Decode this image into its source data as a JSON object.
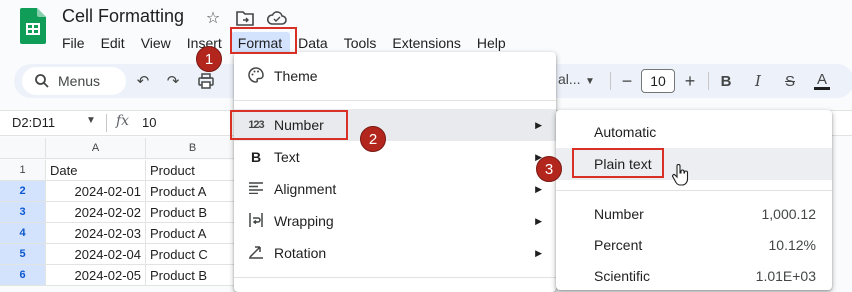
{
  "app": {
    "title": "Cell Formatting",
    "logo_icon": "sheets-logo",
    "brand_color": "#0f9d58"
  },
  "menubar": [
    "File",
    "Edit",
    "View",
    "Insert",
    "Format",
    "Data",
    "Tools",
    "Extensions",
    "Help"
  ],
  "toolbar": {
    "search_label": "Menus",
    "font_size": "10",
    "font_fragment": "al...",
    "icons": [
      "search-icon",
      "undo-icon",
      "redo-icon",
      "print-icon",
      "minus-icon",
      "plus-icon",
      "bold-icon",
      "italic-icon",
      "strikethrough-icon",
      "text-color-icon"
    ]
  },
  "formula_bar": {
    "cell_range": "D2:D11",
    "fx_label": "fx",
    "value": "10"
  },
  "grid": {
    "columns": [
      "A",
      "B"
    ],
    "rows": [
      {
        "num": "1",
        "a": "Date",
        "b": "Product"
      },
      {
        "num": "2",
        "a": "2024-02-01",
        "b": "Product A"
      },
      {
        "num": "3",
        "a": "2024-02-02",
        "b": "Product B"
      },
      {
        "num": "4",
        "a": "2024-02-03",
        "b": "Product A"
      },
      {
        "num": "5",
        "a": "2024-02-04",
        "b": "Product C"
      },
      {
        "num": "6",
        "a": "2024-02-05",
        "b": "Product B"
      }
    ]
  },
  "format_menu": {
    "items": [
      {
        "icon": "palette-icon",
        "label": "Theme",
        "submenu": false
      },
      {
        "icon": "123-icon",
        "label": "Number",
        "submenu": true
      },
      {
        "icon": "bold-icon",
        "label": "Text",
        "submenu": true
      },
      {
        "icon": "align-icon",
        "label": "Alignment",
        "submenu": true
      },
      {
        "icon": "wrap-icon",
        "label": "Wrapping",
        "submenu": true
      },
      {
        "icon": "rotation-icon",
        "label": "Rotation",
        "submenu": true
      }
    ]
  },
  "number_submenu": {
    "items": [
      {
        "label": "Automatic",
        "value": ""
      },
      {
        "label": "Plain text",
        "value": ""
      },
      {
        "label": "Number",
        "value": "1,000.12"
      },
      {
        "label": "Percent",
        "value": "10.12%"
      },
      {
        "label": "Scientific",
        "value": "1.01E+03"
      }
    ]
  },
  "annotations": {
    "step1": "1",
    "step2": "2",
    "step3": "3",
    "color": "#b3261e"
  }
}
